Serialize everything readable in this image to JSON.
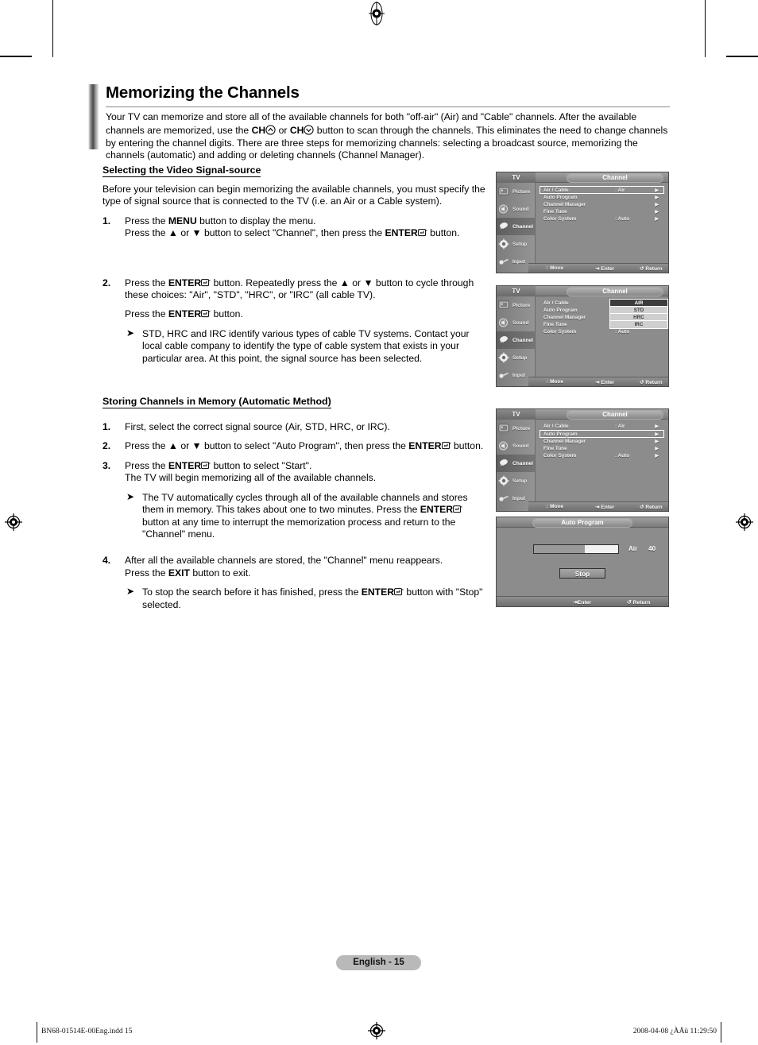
{
  "document": {
    "title": "Memorizing the Channels",
    "intro": "Your TV can memorize and store all of the available channels for both \"off-air\" (Air) and \"Cable\" channels. After the available channels are memorized, use the CH△ or CH▽ button to scan through the channels. This eliminates the need to change channels by entering the channel digits. There are three steps for memorizing channels: selecting a broadcast source, memorizing the channels (automatic) and adding or deleting channels (Channel Manager).",
    "intro_parts": {
      "p1": "Your TV can memorize and store all of the available channels for both \"off-air\" (Air) and \"Cable\" channels. After the available channels are memorized, use the ",
      "ch1": "CH",
      "mid": " or ",
      "ch2": "CH",
      "p2": " button to scan through the channels. This eliminates the need to change channels by entering the channel digits. There are three steps for memorizing channels: selecting a broadcast source, memorizing the channels (automatic) and adding or deleting channels (Channel Manager)."
    }
  },
  "section1": {
    "heading": "Selecting the Video Signal-source",
    "paragraph": "Before your television can begin memorizing the available channels, you must specify the type of signal source that is connected to the TV (i.e. an Air or a Cable system).",
    "step1": {
      "num": "1.",
      "line1_a": "Press the ",
      "line1_b": "MENU",
      "line1_c": " button to display the menu.",
      "line2_a": "Press the ▲ or ▼ button to select \"Channel\", then press the ",
      "line2_b": "ENTER",
      "line2_c": " button."
    },
    "step2": {
      "num": "2.",
      "line1_a": "Press the ",
      "line1_b": "ENTER",
      "line1_c": " button. Repeatedly press the ▲ or ▼ button to cycle through these choices: \"Air\", \"STD\", \"HRC\", or \"IRC\" (all cable TV).",
      "line2_a": "Press the ",
      "line2_b": "ENTER",
      "line2_c": " button.",
      "note": "STD, HRC and IRC identify various types of cable TV systems. Contact your local cable company to identify the type of cable system that exists in your particular area. At this point, the signal source has been selected."
    }
  },
  "section2": {
    "heading": "Storing Channels in Memory (Automatic Method)",
    "step1": {
      "num": "1.",
      "text": "First, select the correct signal source (Air, STD, HRC, or IRC)."
    },
    "step2": {
      "num": "2.",
      "a": "Press the ▲ or ▼ button to select \"Auto Program\", then press the ",
      "b": "ENTER",
      "c": " button."
    },
    "step3": {
      "num": "3.",
      "a": "Press the ",
      "b": "ENTER",
      "c": " button to select \"Start\".",
      "line2": "The TV will begin memorizing  all of the available channels.",
      "note_a": "The TV automatically cycles through all of the available channels and stores them in memory. This takes about one to two minutes. Press the ",
      "note_b": "ENTER",
      "note_c": " button at any time to interrupt the memorization process and return to the \"Channel\" menu."
    },
    "step4": {
      "num": "4.",
      "line1": "After all the available channels are stored, the \"Channel\" menu reappears.",
      "line2_a": "Press the ",
      "line2_b": "EXIT",
      "line2_c": " button to exit.",
      "note_a": "To stop the search before it has finished, press the ",
      "note_b": "ENTER",
      "note_c": " button with \"Stop\" selected."
    }
  },
  "osd": {
    "tv_label": "TV",
    "channel_title": "Channel",
    "sidebar": [
      {
        "label": "Picture",
        "icon": "picture-icon"
      },
      {
        "label": "Sound",
        "icon": "sound-icon"
      },
      {
        "label": "Channel",
        "icon": "channel-icon"
      },
      {
        "label": "Setup",
        "icon": "setup-icon"
      },
      {
        "label": "Input",
        "icon": "input-icon"
      }
    ],
    "menu_rows": [
      {
        "label": "Air / Cable",
        "value": ": Air",
        "arrow": "▶"
      },
      {
        "label": "Auto Program",
        "value": "",
        "arrow": "▶"
      },
      {
        "label": "Channel Manager",
        "value": "",
        "arrow": "▶"
      },
      {
        "label": "Fine Tune",
        "value": "",
        "arrow": "▶"
      },
      {
        "label": "Color System",
        "value": ": Auto",
        "arrow": "▶"
      }
    ],
    "footer": {
      "move": "Move",
      "enter": "Enter",
      "return": "Return"
    },
    "dropdown_options": [
      "AIR",
      "STD",
      "HRC",
      "IRC"
    ],
    "dropdown_selected": "AIR",
    "auto_program": {
      "title": "Auto Program",
      "progress_percent": 60,
      "band": "Air",
      "channel": "40",
      "stop_label": "Stop",
      "enter": "Enter",
      "return": "Return"
    }
  },
  "footer": {
    "page_badge": "English - 15",
    "left": "BN68-01514E-00Eng.indd   15",
    "right": "2008-04-08   ¿ÀÅü 11:29:50"
  }
}
